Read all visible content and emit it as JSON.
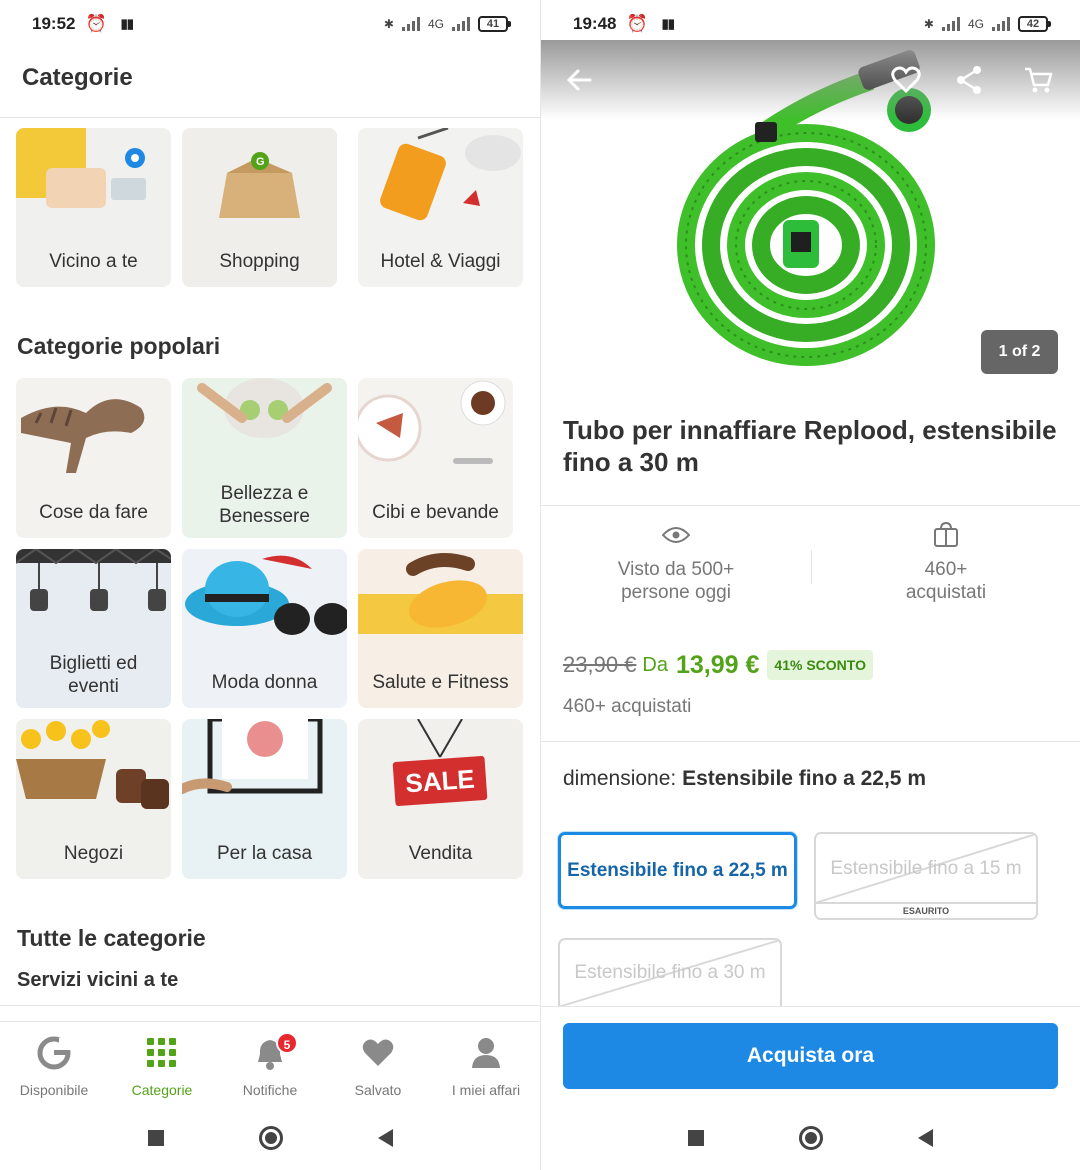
{
  "left": {
    "status": {
      "time": "19:52",
      "battery": "41",
      "network": "4G"
    },
    "title": "Categorie",
    "top_tiles": [
      "Vicino a te",
      "Shopping",
      "Hotel & Viaggi"
    ],
    "popular_title": "Categorie popolari",
    "popular_tiles": [
      "Cose da fare",
      "Bellezza e Benessere",
      "Cibi e bevande",
      "Biglietti ed eventi",
      "Moda donna",
      "Salute e Fitness",
      "Negozi",
      "Per la casa",
      "Vendita"
    ],
    "sale_sign": "SALE",
    "all_title": "Tutte le categorie",
    "services_title": "Servizi vicini a te",
    "tabs": [
      {
        "label": "Disponibile",
        "icon": "groupon-g-icon"
      },
      {
        "label": "Categorie",
        "icon": "grid-icon",
        "active": true
      },
      {
        "label": "Notifiche",
        "icon": "bell-icon",
        "badge": "5"
      },
      {
        "label": "Salvato",
        "icon": "heart-icon"
      },
      {
        "label": "I miei affari",
        "icon": "user-icon"
      }
    ]
  },
  "right": {
    "status": {
      "time": "19:48",
      "battery": "42",
      "network": "4G"
    },
    "image_counter": "1 of 2",
    "title": "Tubo per innaffiare Replood, estensibile fino a 30 m",
    "stats": {
      "viewed": "Visto da 500+ persone oggi",
      "bought": "460+ acquistati"
    },
    "price": {
      "old": "23,90 €",
      "from": "Da",
      "new": "13,99 €",
      "discount": "41% SCONTO"
    },
    "bought_line": "460+ acquistati",
    "dimension": {
      "label": "dimensione:",
      "value": "Estensibile fino a 22,5 m"
    },
    "options": [
      {
        "label": "Estensibile fino a 22,5 m",
        "state": "selected"
      },
      {
        "label": "Estensibile fino a 15 m",
        "state": "sold-out",
        "note": "ESAURITO"
      },
      {
        "label": "Estensibile fino a 30 m",
        "state": "sold-out"
      }
    ],
    "buy_label": "Acquista ora"
  },
  "colors": {
    "accent_green": "#53a318",
    "primary_blue": "#1e88e5",
    "badge_red": "#e8282f"
  }
}
